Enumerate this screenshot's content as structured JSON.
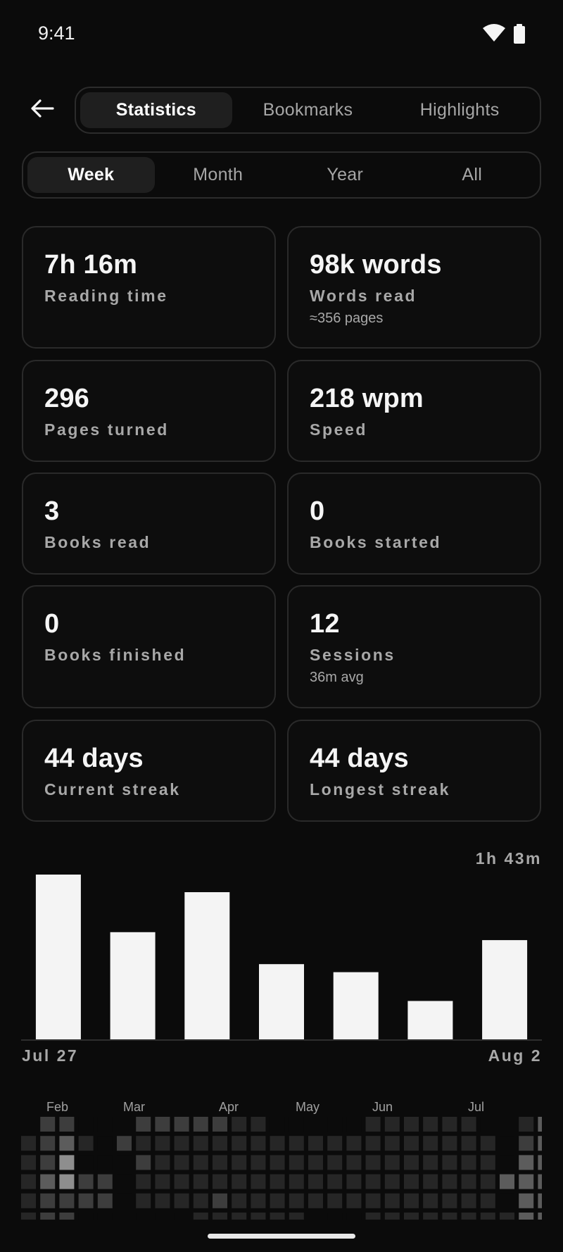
{
  "status": {
    "time": "9:41"
  },
  "tabs": [
    "Statistics",
    "Bookmarks",
    "Highlights"
  ],
  "active_tab": 0,
  "ranges": [
    "Week",
    "Month",
    "Year",
    "All"
  ],
  "active_range": 0,
  "stats": [
    {
      "value": "7h 16m",
      "label": "Reading time",
      "sub": ""
    },
    {
      "value": "98k words",
      "label": "Words read",
      "sub": "≈356 pages"
    },
    {
      "value": "296",
      "label": "Pages turned",
      "sub": ""
    },
    {
      "value": "218 wpm",
      "label": "Speed",
      "sub": ""
    },
    {
      "value": "3",
      "label": "Books read",
      "sub": ""
    },
    {
      "value": "0",
      "label": "Books started",
      "sub": ""
    },
    {
      "value": "0",
      "label": "Books finished",
      "sub": ""
    },
    {
      "value": "12",
      "label": "Sessions",
      "sub": "36m avg"
    },
    {
      "value": "44 days",
      "label": "Current streak",
      "sub": ""
    },
    {
      "value": "44 days",
      "label": "Longest streak",
      "sub": ""
    }
  ],
  "chart_data": {
    "type": "bar",
    "max_label": "1h 43m",
    "start_label": "Jul 27",
    "end_label": "Aug 2",
    "values": [
      103,
      67,
      92,
      47,
      42,
      24,
      62
    ],
    "ylim": [
      0,
      103
    ],
    "bar_color": "#f4f4f4"
  },
  "heatmap": {
    "months": [
      "Feb",
      "Mar",
      "Apr",
      "May",
      "Jun",
      "Jul"
    ],
    "levels": [
      [
        0,
        2,
        2,
        0,
        0,
        0,
        2,
        2,
        2,
        2,
        2,
        1,
        1,
        0,
        0,
        0,
        0,
        0,
        1,
        1,
        1,
        1,
        1,
        1,
        0,
        0,
        1,
        3,
        3,
        2,
        3,
        6
      ],
      [
        1,
        2,
        3,
        1,
        0,
        2,
        1,
        1,
        1,
        1,
        1,
        1,
        1,
        1,
        1,
        1,
        1,
        1,
        1,
        1,
        1,
        1,
        1,
        1,
        1,
        0,
        2,
        3,
        3,
        3,
        5,
        5
      ],
      [
        1,
        2,
        4,
        0,
        0,
        0,
        2,
        1,
        1,
        1,
        1,
        1,
        1,
        1,
        1,
        1,
        1,
        1,
        1,
        1,
        1,
        1,
        1,
        1,
        1,
        0,
        3,
        3,
        5,
        5,
        5,
        5
      ],
      [
        1,
        3,
        4,
        2,
        2,
        0,
        1,
        1,
        1,
        1,
        1,
        1,
        1,
        1,
        1,
        1,
        1,
        1,
        1,
        1,
        1,
        1,
        1,
        1,
        1,
        3,
        3,
        3,
        6,
        3,
        3,
        4
      ],
      [
        1,
        2,
        2,
        2,
        2,
        0,
        1,
        1,
        1,
        1,
        2,
        1,
        1,
        1,
        1,
        1,
        1,
        1,
        1,
        1,
        1,
        1,
        1,
        1,
        1,
        0,
        3,
        3,
        5,
        5,
        3,
        4
      ],
      [
        1,
        2,
        2,
        0,
        0,
        0,
        0,
        0,
        0,
        1,
        1,
        1,
        1,
        1,
        1,
        0,
        0,
        0,
        1,
        1,
        1,
        1,
        1,
        1,
        1,
        1,
        3,
        3,
        4,
        3,
        3,
        3
      ]
    ]
  }
}
